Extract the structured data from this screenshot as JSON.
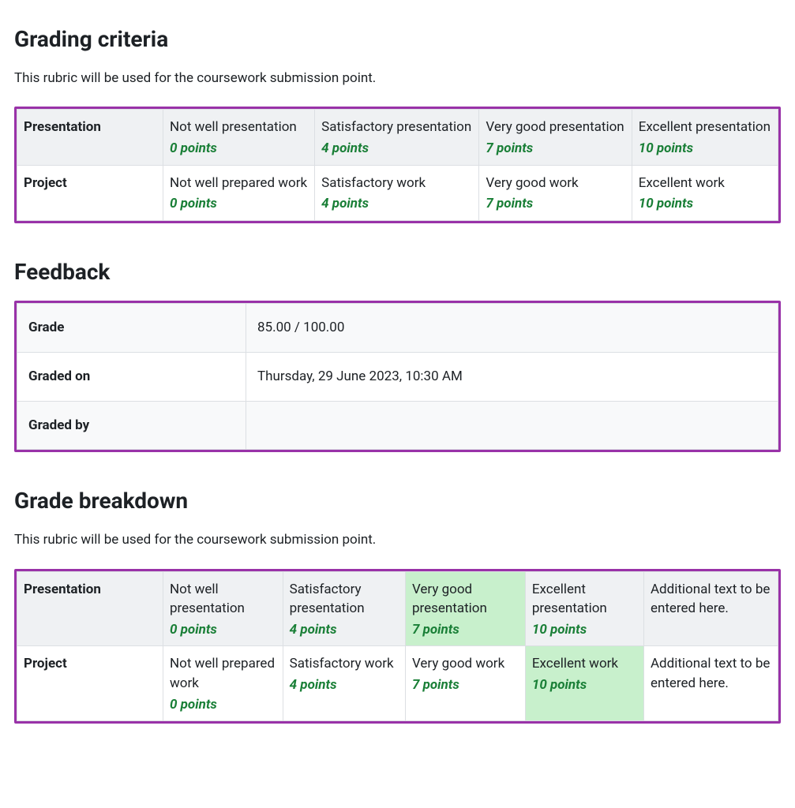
{
  "grading_criteria": {
    "heading": "Grading criteria",
    "intro": "This rubric will be used for the coursework submission point.",
    "rows": [
      {
        "criterion": "Presentation",
        "cells": [
          {
            "desc": "Not well presentation",
            "points": "0 points"
          },
          {
            "desc": "Satisfactory presentation",
            "points": "4 points"
          },
          {
            "desc": "Very good presentation",
            "points": "7 points"
          },
          {
            "desc": "Excellent presentation",
            "points": "10 points"
          }
        ]
      },
      {
        "criterion": "Project",
        "cells": [
          {
            "desc": "Not well prepared work",
            "points": "0 points"
          },
          {
            "desc": "Satisfactory work",
            "points": "4 points"
          },
          {
            "desc": "Very good work",
            "points": "7 points"
          },
          {
            "desc": "Excellent work",
            "points": "10 points"
          }
        ]
      }
    ]
  },
  "feedback": {
    "heading": "Feedback",
    "rows": [
      {
        "label": "Grade",
        "value": "85.00 / 100.00"
      },
      {
        "label": "Graded on",
        "value": "Thursday, 29 June 2023, 10:30 AM"
      },
      {
        "label": "Graded by",
        "value": ""
      }
    ]
  },
  "grade_breakdown": {
    "heading": "Grade breakdown",
    "intro": "This rubric will be used for the coursework submission point.",
    "rows": [
      {
        "criterion": "Presentation",
        "cells": [
          {
            "desc": "Not well presentation",
            "points": "0 points",
            "selected": false
          },
          {
            "desc": "Satisfactory presentation",
            "points": "4 points",
            "selected": false
          },
          {
            "desc": "Very good presentation",
            "points": "7 points",
            "selected": true
          },
          {
            "desc": "Excellent presentation",
            "points": "10 points",
            "selected": false
          }
        ],
        "extra": "Additional text to be entered here."
      },
      {
        "criterion": "Project",
        "cells": [
          {
            "desc": "Not well prepared work",
            "points": "0 points",
            "selected": false
          },
          {
            "desc": "Satisfactory work",
            "points": "4 points",
            "selected": false
          },
          {
            "desc": "Very good work",
            "points": "7 points",
            "selected": false
          },
          {
            "desc": "Excellent work",
            "points": "10 points",
            "selected": true
          }
        ],
        "extra": "Additional text to be entered here."
      }
    ]
  }
}
